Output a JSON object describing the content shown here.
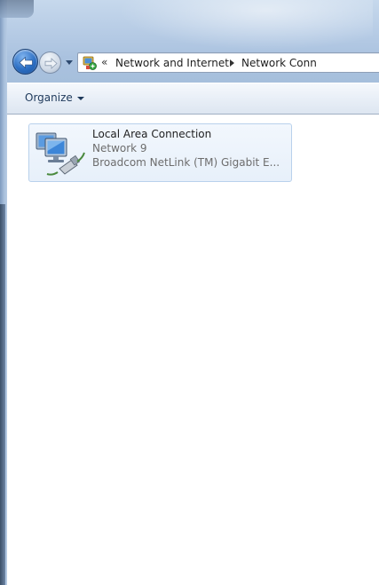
{
  "navigation": {
    "back_icon": "back-arrow-icon",
    "forward_icon": "forward-arrow-icon",
    "recent_icon": "chevron-down-icon",
    "address": {
      "location_icon": "control-panel-icon",
      "overflow": "«",
      "breadcrumbs": [
        "Network and Internet",
        "Network Conn"
      ]
    }
  },
  "command_bar": {
    "organize_label": "Organize"
  },
  "connections": [
    {
      "name": "Local Area Connection",
      "network": "Network  9",
      "adapter": "Broadcom NetLink (TM) Gigabit E...",
      "icon": "network-adapter-icon"
    }
  ],
  "colors": {
    "glass": "#b8cde6",
    "selection_border": "#b9d1ec",
    "selection_fill": "#e7f0fa",
    "link_text": "#1e395b"
  }
}
